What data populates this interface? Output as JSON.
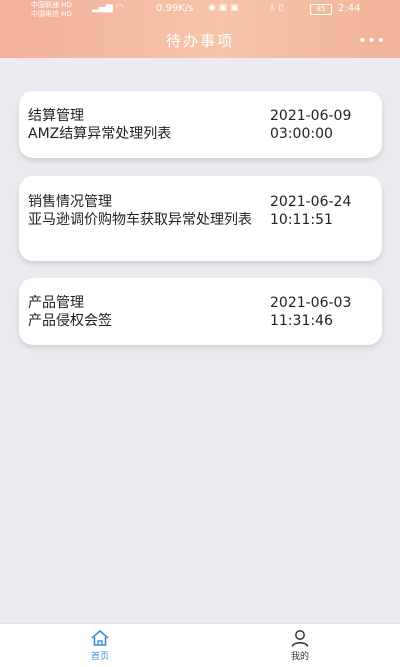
{
  "status_bar": {
    "carrier1": "中国联通",
    "carrier1_badge": "HD",
    "carrier2": "中国电信",
    "carrier2_badge": "HD",
    "net_speed": "0.99K/s",
    "battery": "85",
    "time": "2:44"
  },
  "header": {
    "title": "待办事项",
    "more": "•••"
  },
  "todos": [
    {
      "category": "结算管理",
      "description": "AMZ结算异常处理列表",
      "date": "2021-06-09",
      "time": "03:00:00"
    },
    {
      "category": "销售情况管理",
      "description": "亚马逊调价购物车获取异常处理列表",
      "date": "2021-06-24",
      "time": "10:11:51"
    },
    {
      "category": "产品管理",
      "description": "产品侵权会签",
      "date": "2021-06-03",
      "time": "11:31:46"
    }
  ],
  "nav": {
    "home_label": "首页",
    "mine_label": "我的",
    "active_color": "#3b8fd9",
    "inactive_color": "#333333"
  }
}
